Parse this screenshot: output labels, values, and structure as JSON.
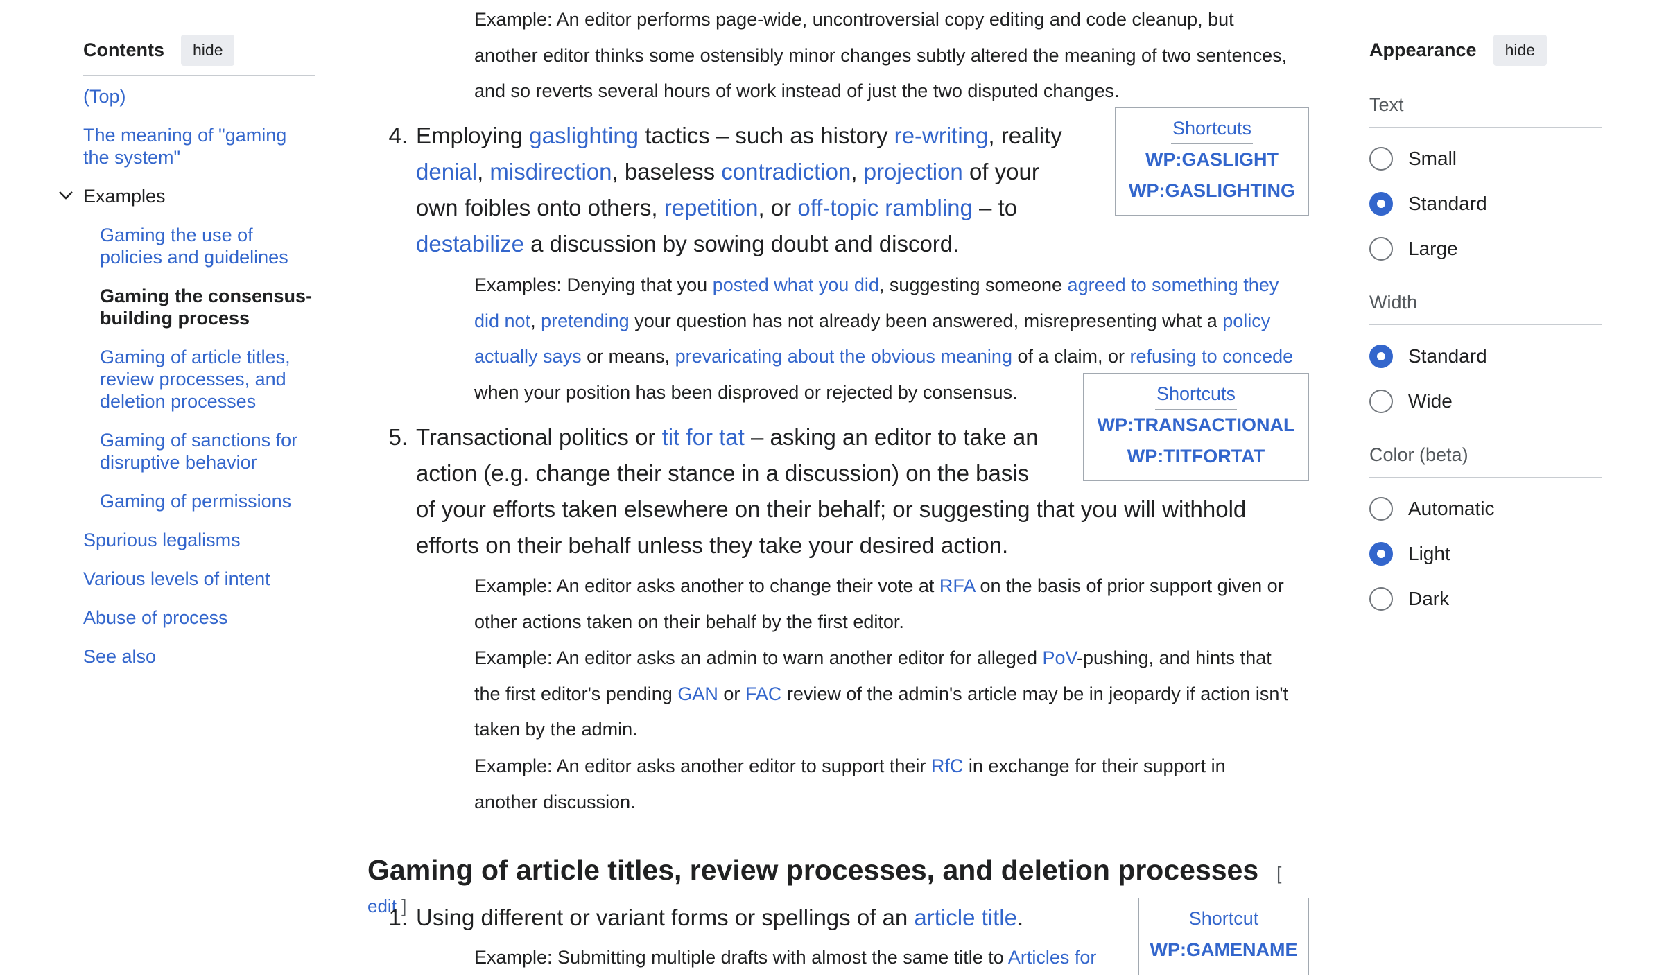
{
  "toc": {
    "title": "Contents",
    "hide_label": "hide",
    "items": [
      {
        "label": "(Top)"
      },
      {
        "label": "The meaning of \"gaming the system\""
      },
      {
        "label": "Examples"
      },
      {
        "label": "Gaming the use of policies and guidelines"
      },
      {
        "label": "Gaming the consensus-building process"
      },
      {
        "label": "Gaming of article titles, review processes, and deletion processes"
      },
      {
        "label": "Gaming of sanctions for disruptive behavior"
      },
      {
        "label": "Gaming of permissions"
      },
      {
        "label": "Spurious legalisms"
      },
      {
        "label": "Various levels of intent"
      },
      {
        "label": "Abuse of process"
      },
      {
        "label": "See also"
      }
    ]
  },
  "content": {
    "ex0": [
      "Example: An editor performs page-wide, uncontroversial copy editing and code cleanup, but",
      "another editor thinks some ostensibly minor changes subtly altered the meaning of two sentences,",
      "and so reverts several hours of work instead of just the two disputed changes."
    ],
    "item4": {
      "num": "4.",
      "line1": [
        "Employing ",
        "gaslighting",
        " tactics – such as history ",
        "re-writing",
        ", reality"
      ],
      "line2": [
        "denial",
        ", ",
        "misdirection",
        ", baseless ",
        "contradiction",
        ", ",
        "projection",
        " of your"
      ],
      "line3": [
        "own foibles onto others, ",
        "repetition",
        ", or ",
        "off-topic rambling",
        " – to"
      ],
      "line4": [
        "destabilize",
        " a discussion by sowing doubt and discord."
      ]
    },
    "shortcut1": {
      "title": "Shortcuts",
      "links": [
        "WP:GASLIGHT",
        "WP:GASLIGHTING"
      ]
    },
    "ex4": {
      "line1": [
        "Examples: Denying that you ",
        "posted what you did",
        ", suggesting someone ",
        "agreed to something they"
      ],
      "line2": [
        "did not",
        ", ",
        "pretending",
        " your question has not already been answered, misrepresenting what a ",
        "policy"
      ],
      "line3": [
        "actually says",
        " or means, ",
        "prevaricating about the obvious meaning",
        " of a claim, or ",
        "refusing to concede"
      ],
      "line4": [
        "when your position has been disproved or rejected by consensus."
      ]
    },
    "shortcut2": {
      "title": "Shortcuts",
      "links": [
        "WP:TRANSACTIONAL",
        "WP:TITFORTAT"
      ]
    },
    "item5": {
      "num": "5.",
      "line1": [
        "Transactional politics or ",
        "tit for tat",
        " – asking an editor to take an"
      ],
      "line2": [
        "action (e.g. change their stance in a discussion) on the basis"
      ],
      "line3": [
        "of your efforts taken elsewhere on their behalf; or suggesting that you will withhold"
      ],
      "line4": [
        "efforts on their behalf unless they take your desired action."
      ]
    },
    "ex5a": {
      "line1": [
        "Example: An editor asks another to change their vote at ",
        "RFA",
        " on the basis of prior support given or"
      ],
      "line2": [
        "other actions taken on their behalf by the first editor."
      ]
    },
    "ex5b": {
      "line1": [
        "Example: An editor asks an admin to warn another editor for alleged ",
        "PoV",
        "-pushing, and hints that"
      ],
      "line2": [
        "the first editor's pending ",
        "GAN",
        " or ",
        "FAC",
        " review of the admin's article may be in jeopardy if action isn't"
      ],
      "line3": [
        "taken by the admin."
      ]
    },
    "ex5c": {
      "line1": [
        "Example: An editor asks another editor to support their ",
        "RfC",
        " in exchange for their support in"
      ],
      "line2": [
        "another discussion."
      ]
    },
    "section": {
      "title": "Gaming of article titles, review processes, and deletion processes",
      "edit_open": "[",
      "edit_label": "edit",
      "edit_close": "]"
    },
    "item1": {
      "num": "1.",
      "line1": [
        "Using different or variant forms or spellings of an ",
        "article title",
        "."
      ]
    },
    "shortcut3": {
      "title": "Shortcut",
      "links": [
        "WP:GAMENAME"
      ]
    },
    "ex1": {
      "line1": [
        "Example: Submitting multiple drafts with almost the same title to ",
        "Articles for"
      ]
    }
  },
  "appearance": {
    "title": "Appearance",
    "hide_label": "hide",
    "groups": [
      {
        "label": "Text",
        "options": [
          {
            "label": "Small",
            "selected": false
          },
          {
            "label": "Standard",
            "selected": true
          },
          {
            "label": "Large",
            "selected": false
          }
        ]
      },
      {
        "label": "Width",
        "options": [
          {
            "label": "Standard",
            "selected": true
          },
          {
            "label": "Wide",
            "selected": false
          }
        ]
      },
      {
        "label": "Color (beta)",
        "options": [
          {
            "label": "Automatic",
            "selected": false
          },
          {
            "label": "Light",
            "selected": true
          },
          {
            "label": "Dark",
            "selected": false
          }
        ]
      }
    ]
  },
  "colors": {
    "link": "#3366cc",
    "text": "#202122",
    "muted": "#54595d",
    "radio_selected": "#3366cc"
  }
}
